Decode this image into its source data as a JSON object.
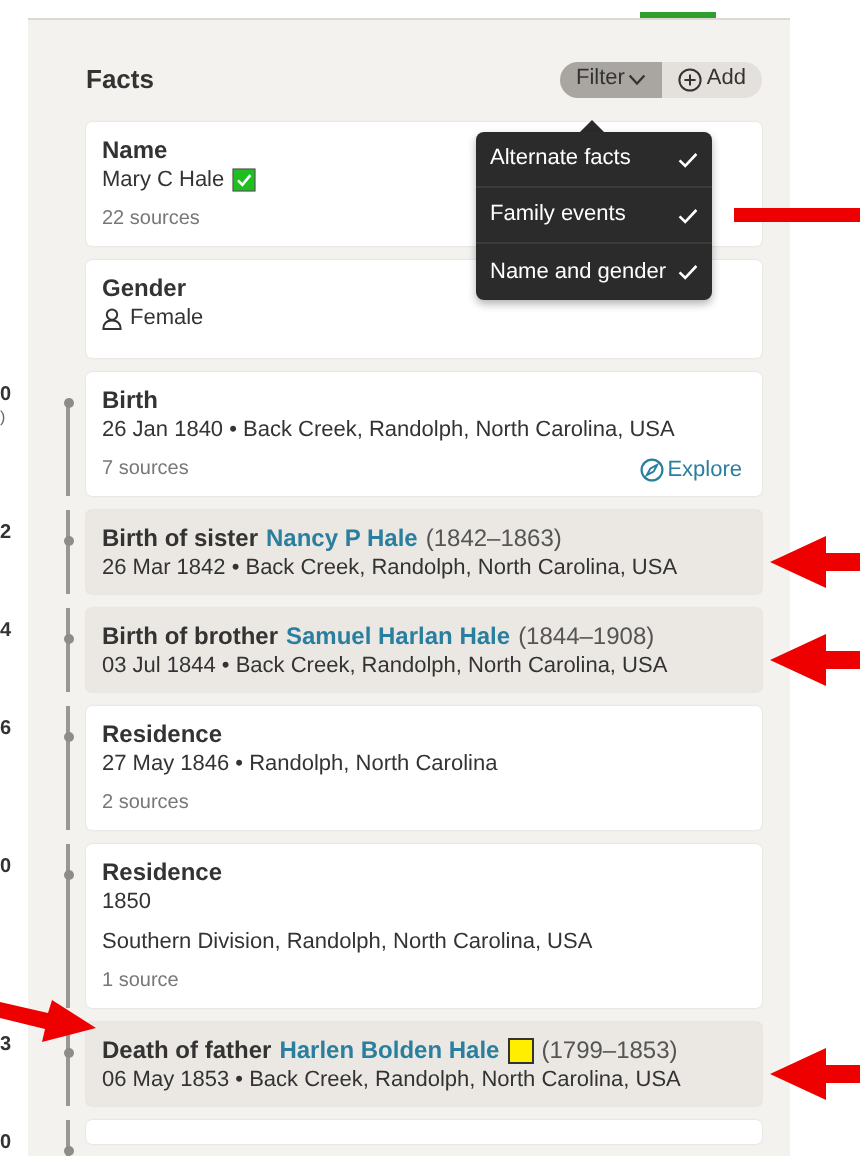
{
  "header": {
    "title": "Facts",
    "filter_button": "Filter",
    "add_button": "Add"
  },
  "filter_menu": {
    "open": true,
    "items": [
      {
        "label": "Alternate facts",
        "checked": true,
        "arrow": false
      },
      {
        "label": "Family events",
        "checked": true,
        "arrow": true
      },
      {
        "label": "Name and gender",
        "checked": true,
        "arrow": false
      }
    ]
  },
  "facts": [
    {
      "kind": "fact",
      "title": "Name",
      "value": "Mary C Hale",
      "marker": {
        "kind": "check",
        "color": "#1fbf1f"
      },
      "sources": "22 sources"
    },
    {
      "kind": "gender",
      "title": "Gender",
      "value": "Female"
    },
    {
      "kind": "fact",
      "year": "0",
      "year_note": ")",
      "title": "Birth",
      "lines": [
        "26 Jan 1840 • Back Creek, Randolph, North Carolina, USA"
      ],
      "sources": "7 sources",
      "action": "Explore"
    },
    {
      "kind": "family",
      "year": "2",
      "relation": "Birth of sister",
      "person": "Nancy P Hale",
      "dates": "(1842–1863)",
      "lines": [
        "26 Mar 1842 • Back Creek, Randolph, North Carolina, USA"
      ],
      "arrow_right": true
    },
    {
      "kind": "family",
      "year": "4",
      "relation": "Birth of brother",
      "person": "Samuel Harlan Hale",
      "dates": "(1844–1908)",
      "lines": [
        "03 Jul 1844 • Back Creek, Randolph, North Carolina, USA"
      ],
      "arrow_right": true
    },
    {
      "kind": "fact",
      "year": "6",
      "title": "Residence",
      "lines": [
        "27 May 1846 • Randolph, North Carolina"
      ],
      "sources": "2 sources"
    },
    {
      "kind": "fact",
      "year": "0",
      "title": "Residence",
      "lines": [
        "1850",
        "Southern Division, Randolph, North Carolina, USA"
      ],
      "sources": "1 source"
    },
    {
      "kind": "family",
      "year": "3",
      "relation": "Death of father",
      "person": "Harlen Bolden Hale",
      "marker": {
        "kind": "square",
        "color": "#ffee00"
      },
      "dates": "(1799–1853)",
      "lines": [
        "06 May 1853 • Back Creek, Randolph, North Carolina, USA"
      ],
      "arrow_right": true,
      "arrow_left": true
    },
    {
      "kind": "stub",
      "year": "0"
    }
  ]
}
